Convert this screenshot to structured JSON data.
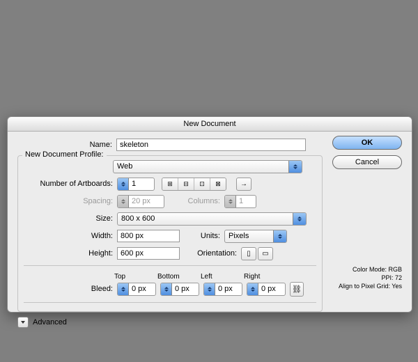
{
  "dialog": {
    "title": "New Document",
    "name_label": "Name:",
    "name_value": "skeleton",
    "profile_legend": "New Document Profile:",
    "profile_value": "Web",
    "artboards_label": "Number of Artboards:",
    "artboards_value": "1",
    "spacing_label": "Spacing:",
    "spacing_value": "20 px",
    "columns_label": "Columns:",
    "columns_value": "1",
    "size_label": "Size:",
    "size_value": "800 x 600",
    "width_label": "Width:",
    "width_value": "800 px",
    "height_label": "Height:",
    "height_value": "600 px",
    "units_label": "Units:",
    "units_value": "Pixels",
    "orientation_label": "Orientation:",
    "bleed_label": "Bleed:",
    "bleed_top_label": "Top",
    "bleed_bottom_label": "Bottom",
    "bleed_left_label": "Left",
    "bleed_right_label": "Right",
    "bleed_top": "0 px",
    "bleed_bottom": "0 px",
    "bleed_left": "0 px",
    "bleed_right": "0 px",
    "advanced_label": "Advanced",
    "ok_label": "OK",
    "cancel_label": "Cancel",
    "info_colormode": "Color Mode: RGB",
    "info_ppi": "PPI: 72",
    "info_pixelgrid": "Align to Pixel Grid: Yes",
    "arrow_icon": "→",
    "grid1": "⊞",
    "grid2": "⊟",
    "grid3": "⊡",
    "grid4": "⊠",
    "orient_portrait": "▯",
    "orient_landscape": "▭",
    "link_icon": "⛓"
  }
}
